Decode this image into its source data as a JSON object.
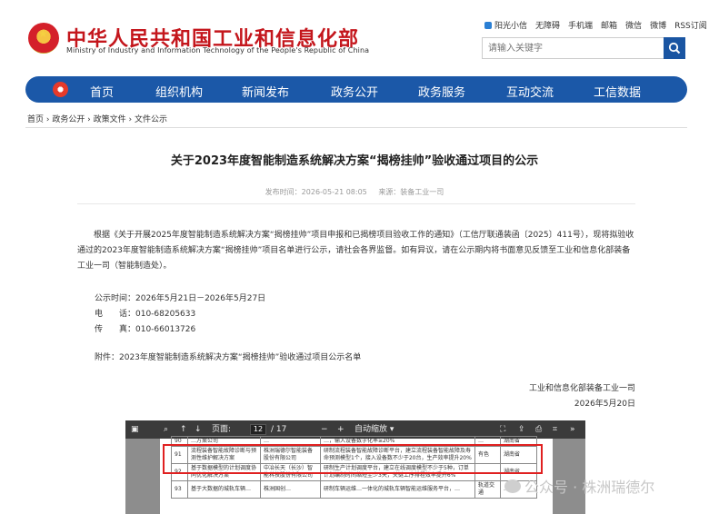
{
  "header": {
    "title": "中华人民共和国工业和信息化部",
    "subtitle": "Ministry of Industry and Information Technology of the People's Republic of China",
    "top_links": [
      "阳光小信",
      "无障碍",
      "手机端",
      "邮箱",
      "微信",
      "微博",
      "RSS订阅"
    ],
    "search_placeholder": "请输入关键字"
  },
  "nav": [
    "首页",
    "组织机构",
    "新闻发布",
    "政务公开",
    "政务服务",
    "互动交流",
    "工信数据"
  ],
  "breadcrumb": "首页 › 政务公开 › 政策文件 › 文件公示",
  "article": {
    "title": "关于2023年度智能制造系统解决方案“揭榜挂帅”验收通过项目的公示",
    "published": "发布时间：2026-05-21 08:05",
    "source": "来源：装备工业一司",
    "body": "根据《关于开展2025年度智能制造系统解决方案“揭榜挂帅”项目申报和已揭榜项目验收工作的通知》（工信厅联通装函〔2025〕411号），现将拟验收通过的2023年度智能制造系统解决方案“揭榜挂帅”项目名单进行公示，请社会各界监督。如有异议，请在公示期内将书面意见反馈至工业和信息化部装备工业一司（智能制造处）。",
    "period": "公示时间：2026年5月21日－2026年5月27日",
    "phone": "电　　话：010-68205633",
    "fax": "传　　真：010-66013726",
    "attachment": "附件：2023年度智能制造系统解决方案“揭榜挂帅”验收通过项目公示名单",
    "signature_org": "工业和信息化部装备工业一司",
    "signature_date": "2026年5月20日"
  },
  "pdf_viewer": {
    "page_label": "页面:",
    "page_current": "12",
    "page_total": "/ 17",
    "zoom_label": "自动缩放",
    "rows": [
      [
        "90",
        "…方案公司",
        "…",
        "…，输入设备数字化率≥20%",
        "…",
        "湖南省"
      ],
      [
        "91",
        "流程装备智能故障诊断与预测性维护解决方案",
        "株洲瑞德尔智能装备股份有限公司",
        "研制流程装备智能故障诊断平台，建立流程装备智能故障及寿命预测模型1个，接入设备数不少于20台，生产效率提升20%",
        "有色",
        "湖南省"
      ],
      [
        "92",
        "基于数据模型的计划调度协同优化解决方案",
        "中冶长天（长沙）智能科技股份有限公司",
        "研制生产计划调度平台，建立在线调度模型不少于5种，订单计划编制时间缩短至少3天，关键工序排程效率提升6%",
        "…",
        "湖南省"
      ],
      [
        "93",
        "基于大数据的城轨车辆…",
        "株洲国创…",
        "研制车辆运维…一体化的城轨车辆智能运维服务平台，…",
        "轨道交通",
        "…"
      ]
    ]
  },
  "watermark": "公众号 · 株洲瑞德尔",
  "colors": {
    "brand_red": "#c4161c",
    "nav_blue": "#1b58a8",
    "highlight_red": "#e02020"
  }
}
